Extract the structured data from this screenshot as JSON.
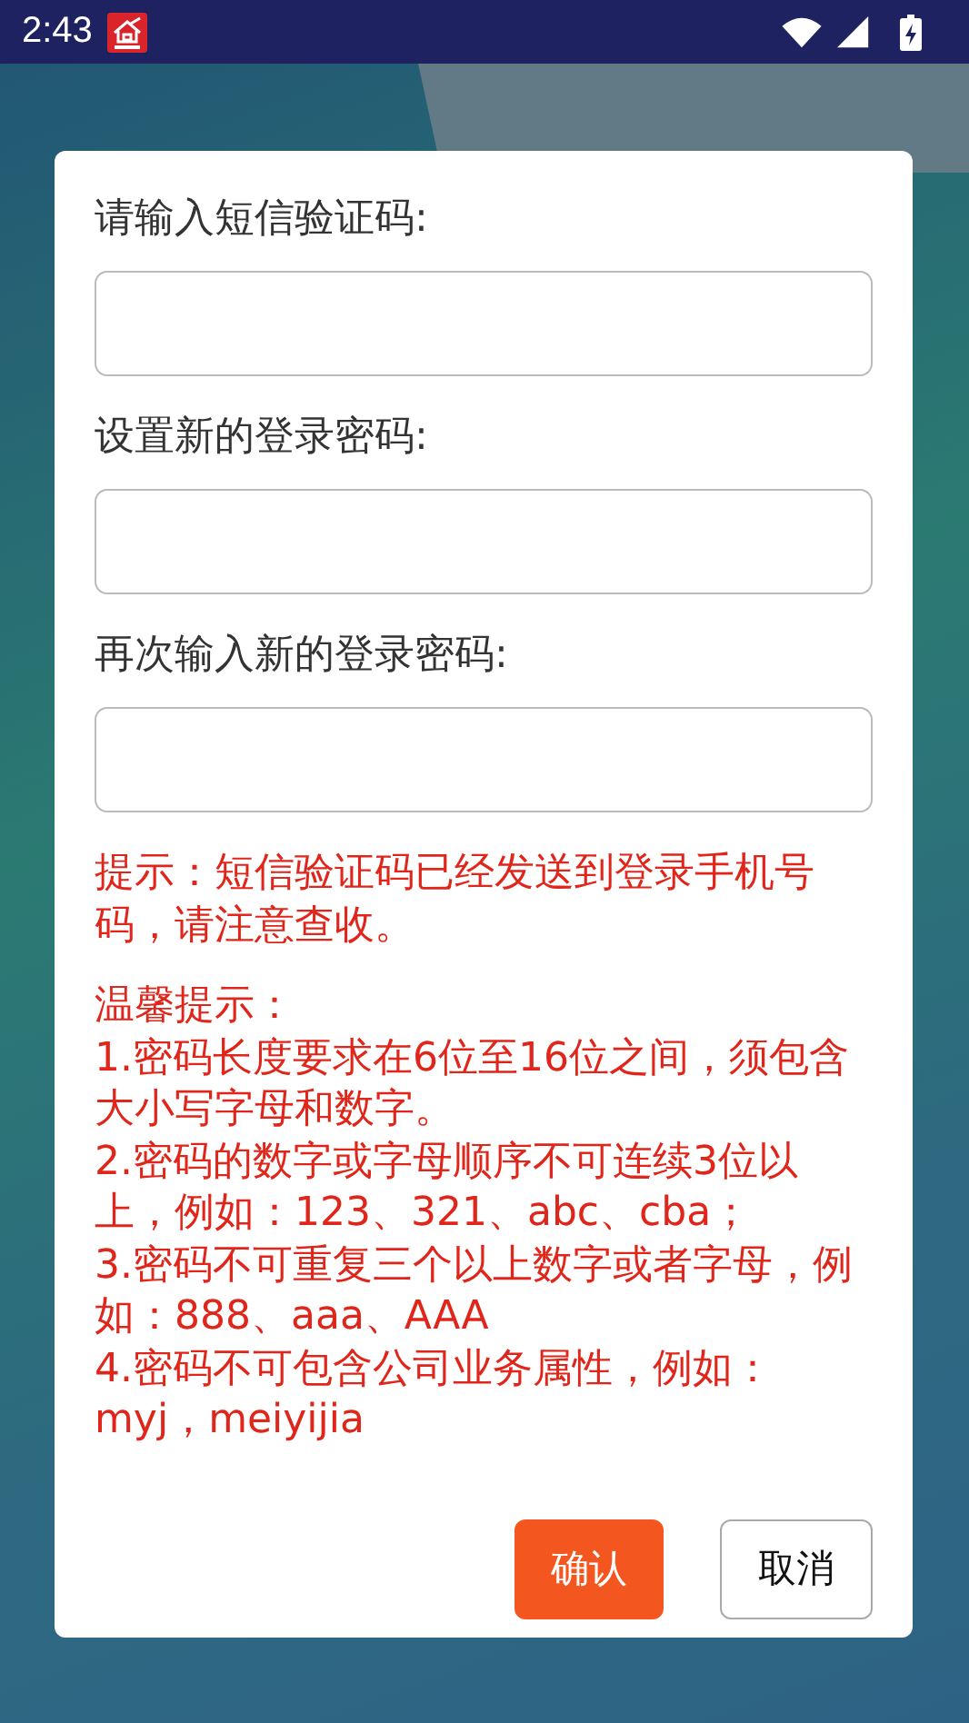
{
  "status_bar": {
    "time": "2:43"
  },
  "dialog": {
    "fields": [
      {
        "label": "请输入短信验证码:"
      },
      {
        "label": "设置新的登录密码:"
      },
      {
        "label": "再次输入新的登录密码:"
      }
    ],
    "notice": "提示：短信验证码已经发送到登录手机号码，请注意查收。",
    "tips": {
      "title": "温馨提示：",
      "items": [
        "1.密码长度要求在6位至16位之间，须包含大小写字母和数字。",
        "2.密码的数字或字母顺序不可连续3位以上，例如：123、321、abc、cba；",
        "3.密码不可重复三个以上数字或者字母，例如：888、aaa、AAA",
        "4.密码不可包含公司业务属性，例如：myj，meiyijia"
      ]
    },
    "buttons": [
      {
        "label": "确认",
        "kind": "primary"
      },
      {
        "label": "取消",
        "kind": "secondary"
      }
    ]
  }
}
